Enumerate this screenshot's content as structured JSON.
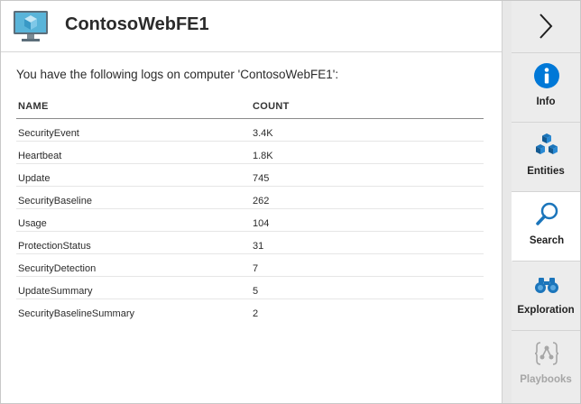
{
  "header": {
    "title": "ContosoWebFE1",
    "icon": "computer-icon"
  },
  "intro_text": "You have the following logs on computer 'ContosoWebFE1':",
  "table": {
    "columns": [
      "NAME",
      "COUNT"
    ],
    "rows": [
      {
        "name": "SecurityEvent",
        "count": "3.4K"
      },
      {
        "name": "Heartbeat",
        "count": "1.8K"
      },
      {
        "name": "Update",
        "count": "745"
      },
      {
        "name": "SecurityBaseline",
        "count": "262"
      },
      {
        "name": "Usage",
        "count": "104"
      },
      {
        "name": "ProtectionStatus",
        "count": "31"
      },
      {
        "name": "SecurityDetection",
        "count": "7"
      },
      {
        "name": "UpdateSummary",
        "count": "5"
      },
      {
        "name": "SecurityBaselineSummary",
        "count": "2"
      }
    ]
  },
  "sidebar": {
    "toggle_icon": "chevron-right-icon",
    "items": [
      {
        "label": "Info",
        "icon": "info-icon",
        "active": false,
        "disabled": false
      },
      {
        "label": "Entities",
        "icon": "cubes-icon",
        "active": false,
        "disabled": false
      },
      {
        "label": "Search",
        "icon": "search-icon",
        "active": true,
        "disabled": false
      },
      {
        "label": "Exploration",
        "icon": "binoculars-icon",
        "active": false,
        "disabled": false
      },
      {
        "label": "Playbooks",
        "icon": "playbooks-icon",
        "active": false,
        "disabled": true
      }
    ]
  },
  "colors": {
    "accent_blue": "#0078d7",
    "icon_blue": "#1b75bb",
    "disabled_gray": "#a6a6a6",
    "sidebar_bg": "#ececec"
  }
}
